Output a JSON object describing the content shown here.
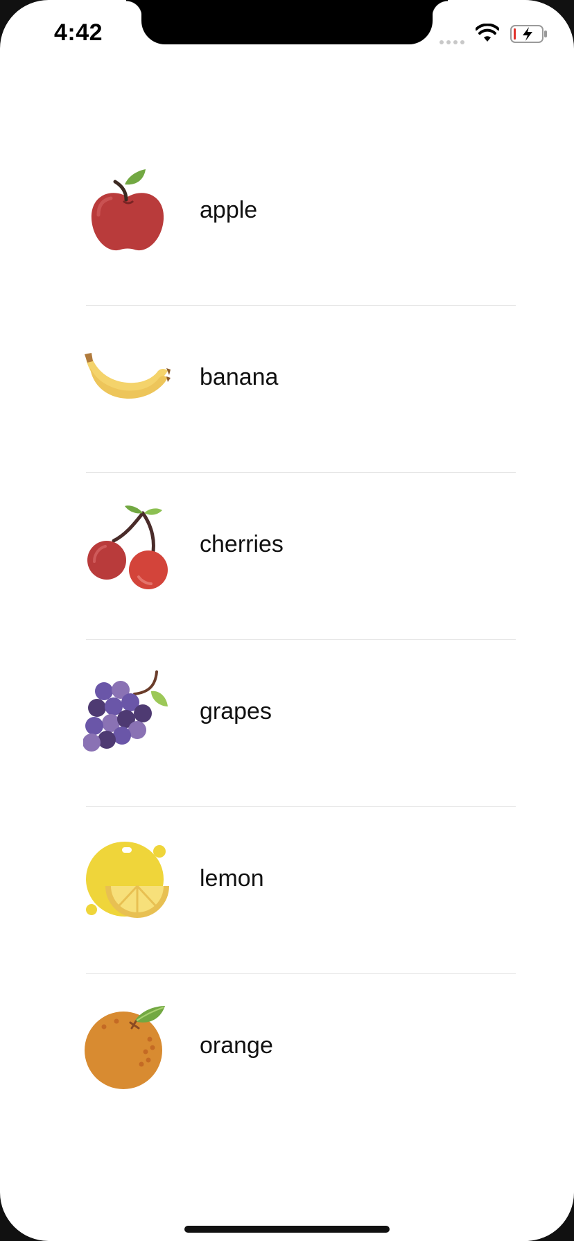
{
  "status_bar": {
    "time": "4:42"
  },
  "fruit_list": {
    "items": [
      {
        "label": "apple",
        "icon": "apple-icon"
      },
      {
        "label": "banana",
        "icon": "banana-icon"
      },
      {
        "label": "cherries",
        "icon": "cherries-icon"
      },
      {
        "label": "grapes",
        "icon": "grapes-icon"
      },
      {
        "label": "lemon",
        "icon": "lemon-icon"
      },
      {
        "label": "orange",
        "icon": "orange-icon"
      }
    ]
  },
  "colors": {
    "apple": "#b93b3b",
    "banana": "#f4d36b",
    "cherries": "#d3443a",
    "grapes": "#6a56a8",
    "lemon": "#efd53a",
    "orange": "#d88b31",
    "leaf": "#72a842"
  }
}
